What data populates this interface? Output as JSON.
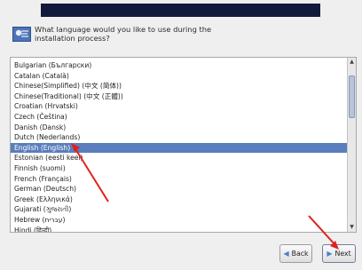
{
  "header": {
    "question": "What language would you like to use during the\ninstallation process?"
  },
  "languages": [
    "Bulgarian (Български)",
    "Catalan (Català)",
    "Chinese(Simplified) (中文 (简体))",
    "Chinese(Traditional) (中文 (正體))",
    "Croatian (Hrvatski)",
    "Czech (Čeština)",
    "Danish (Dansk)",
    "Dutch (Nederlands)",
    "English (English)",
    "Estonian (eesti keel)",
    "Finnish (suomi)",
    "French (Français)",
    "German (Deutsch)",
    "Greek (Ελληνικά)",
    "Gujarati (ગુજરાતી)",
    "Hebrew (עברית)",
    "Hindi (हिन्दी)"
  ],
  "selected_language": "English (English)",
  "buttons": {
    "back_label": "Back",
    "next_label": "Next"
  },
  "icons": {
    "flag": "language-flag-icon",
    "back": "arrow-left-icon",
    "next": "arrow-right-icon"
  },
  "colors": {
    "selection": "#5a7ebd",
    "annotation_arrow": "#e0201e",
    "top_bar": "#121a3c"
  }
}
